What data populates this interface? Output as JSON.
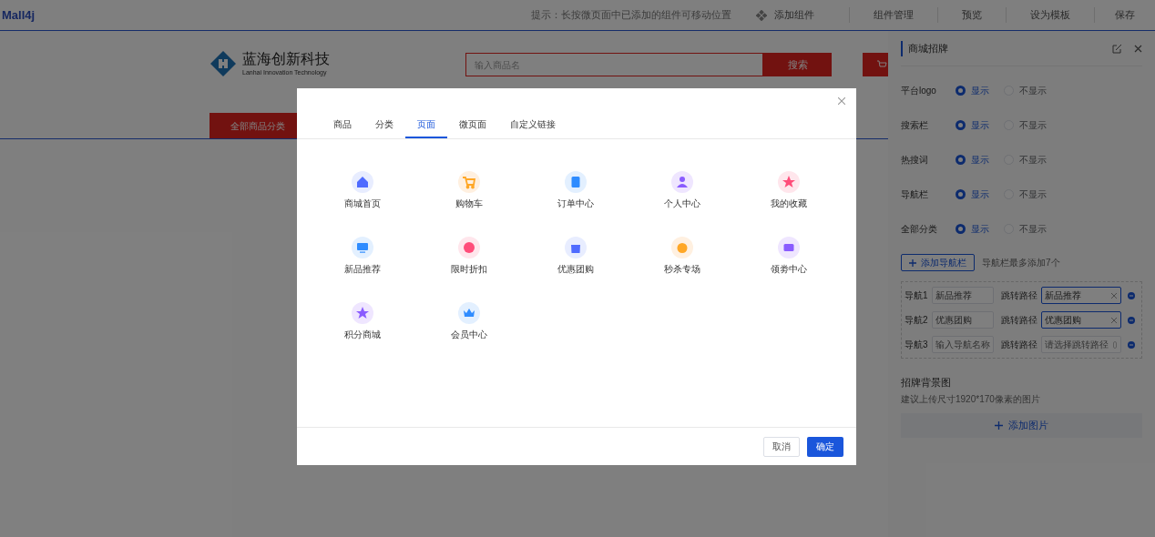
{
  "topbar": {
    "logo": "Mall4j",
    "hint": "提示：长按微页面中已添加的组件可移动位置",
    "actions": [
      "添加组件",
      "组件管理",
      "预览",
      "设为模板",
      "保存"
    ]
  },
  "store_header": {
    "brand": "蓝海创新科技",
    "brand_en": "Lanhai Innovation Technology",
    "search_placeholder": "输入商品名",
    "search_button": "搜索",
    "nav_category": "全部商品分类"
  },
  "dialog": {
    "tabs": [
      {
        "label": "商品",
        "selected": false
      },
      {
        "label": "分类",
        "selected": false
      },
      {
        "label": "页面",
        "selected": true
      },
      {
        "label": "微页面",
        "selected": false
      },
      {
        "label": "自定义链接",
        "selected": false
      }
    ],
    "pages": [
      {
        "label": "商城首页"
      },
      {
        "label": "购物车"
      },
      {
        "label": "订单中心"
      },
      {
        "label": "个人中心"
      },
      {
        "label": "我的收藏"
      },
      {
        "label": "新品推荐"
      },
      {
        "label": "限时折扣"
      },
      {
        "label": "优惠团购"
      },
      {
        "label": "秒杀专场"
      },
      {
        "label": "领劵中心"
      },
      {
        "label": "积分商城"
      },
      {
        "label": "会员中心"
      }
    ],
    "buttons": [
      "取消",
      "确定"
    ]
  },
  "panel": {
    "title": "商城招牌",
    "settings": [
      {
        "label": "平台logo",
        "options": [
          {
            "label": "显示",
            "selected": true
          },
          {
            "label": "不显示",
            "selected": false
          }
        ]
      },
      {
        "label": "搜索栏",
        "options": [
          {
            "label": "显示",
            "selected": true
          },
          {
            "label": "不显示",
            "selected": false
          }
        ]
      },
      {
        "label": "热搜词",
        "options": [
          {
            "label": "显示",
            "selected": true
          },
          {
            "label": "不显示",
            "selected": false
          }
        ]
      },
      {
        "label": "导航栏",
        "options": [
          {
            "label": "显示",
            "selected": true
          },
          {
            "label": "不显示",
            "selected": false
          }
        ]
      },
      {
        "label": "全部分类",
        "options": [
          {
            "label": "显示",
            "selected": true
          },
          {
            "label": "不显示",
            "selected": false
          }
        ]
      }
    ],
    "add_nav_button": "添加导航栏",
    "add_nav_hint": "导航栏最多添加7个",
    "navs": [
      {
        "label": "导航1",
        "name_value": "新品推荐",
        "path_label": "跳转路径",
        "path_value": "新品推荐"
      },
      {
        "label": "导航2",
        "name_value": "优惠团购",
        "path_label": "跳转路径",
        "path_value": "优惠团购"
      },
      {
        "label": "导航3",
        "name_placeholder": "输入导航名称",
        "path_label": "跳转路径",
        "path_placeholder": "请选择跳转路径"
      }
    ],
    "bg_title": "招牌背景图",
    "bg_hint": "建议上传尺寸1920*170像素的图片",
    "add_image_button": "添加图片"
  }
}
